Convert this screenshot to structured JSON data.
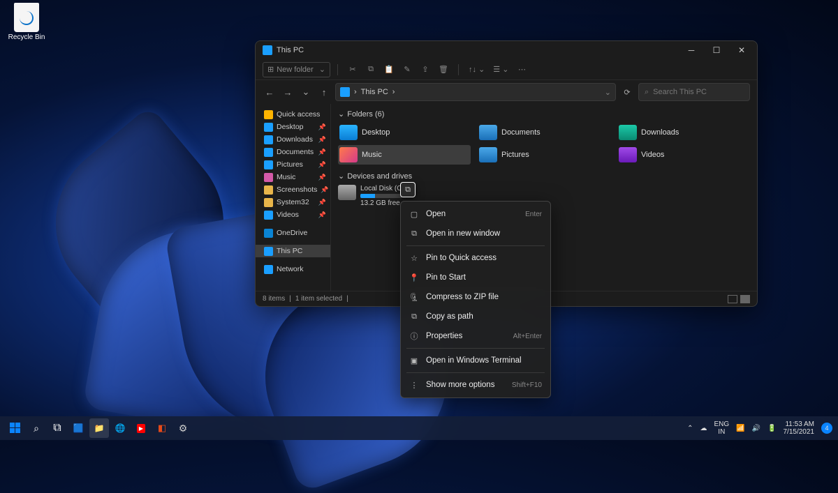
{
  "desktop": {
    "recycle_bin": "Recycle Bin"
  },
  "window": {
    "title": "This PC",
    "toolbar": {
      "new_folder": "New folder"
    },
    "address": {
      "location": "This PC",
      "chevron": "›"
    },
    "search": {
      "placeholder": "Search This PC"
    },
    "sidebar": {
      "quick_access": "Quick access",
      "items": [
        {
          "label": "Desktop",
          "color": "#1a9fff",
          "pin": true
        },
        {
          "label": "Downloads",
          "color": "#1a9fff",
          "pin": true
        },
        {
          "label": "Documents",
          "color": "#1a9fff",
          "pin": true
        },
        {
          "label": "Pictures",
          "color": "#1a9fff",
          "pin": true
        },
        {
          "label": "Music",
          "color": "#d45aa8",
          "pin": true
        },
        {
          "label": "Screenshots",
          "color": "#e8b54a",
          "pin": true
        },
        {
          "label": "System32",
          "color": "#e8b54a",
          "pin": true
        },
        {
          "label": "Videos",
          "color": "#1a9fff",
          "pin": true
        }
      ],
      "onedrive": "OneDrive",
      "this_pc": "This PC",
      "network": "Network"
    },
    "content": {
      "folders_header": "Folders (6)",
      "folders": [
        "Desktop",
        "Documents",
        "Downloads",
        "Music",
        "Pictures",
        "Videos"
      ],
      "drives_header": "Devices and drives",
      "drive": {
        "name": "Local Disk (C:)",
        "free": "13.2 GB free"
      }
    },
    "statusbar": {
      "items": "8 items",
      "selected": "1 item selected"
    }
  },
  "context_menu": {
    "open": "Open",
    "open_sc": "Enter",
    "open_new": "Open in new window",
    "pin_qa": "Pin to Quick access",
    "pin_start": "Pin to Start",
    "compress": "Compress to ZIP file",
    "copy_path": "Copy as path",
    "properties": "Properties",
    "properties_sc": "Alt+Enter",
    "terminal": "Open in Windows Terminal",
    "more": "Show more options",
    "more_sc": "Shift+F10"
  },
  "taskbar": {
    "lang": "ENG",
    "locale": "IN",
    "time": "11:53 AM",
    "date": "7/15/2021"
  }
}
